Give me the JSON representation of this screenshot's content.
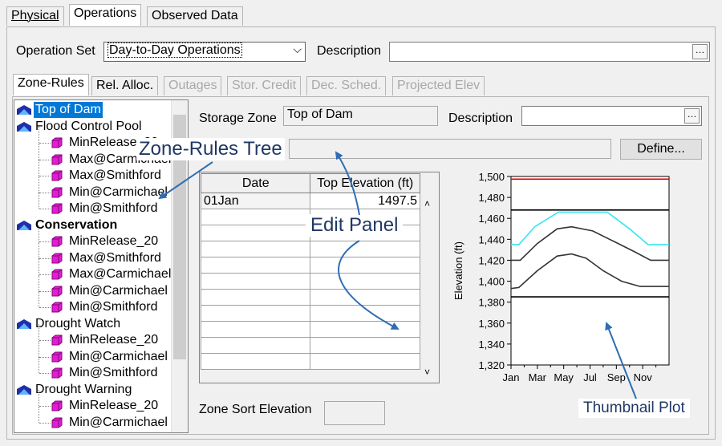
{
  "tabs": [
    {
      "label": "Physical",
      "mnemonic": "P"
    },
    {
      "label": "Operations",
      "mnemonic": "O"
    },
    {
      "label": "Observed Data",
      "mnemonic": "b"
    }
  ],
  "operation_set": {
    "label": "Operation Set",
    "value": "Day-to-Day Operations",
    "description_label": "Description",
    "description_value": ""
  },
  "subtabs": [
    {
      "label": "Zone-Rules",
      "enabled": true
    },
    {
      "label": "Rel. Alloc.",
      "enabled": true
    },
    {
      "label": "Outages",
      "enabled": false
    },
    {
      "label": "Stor. Credit",
      "enabled": false
    },
    {
      "label": "Dec. Sched.",
      "enabled": false
    },
    {
      "label": "Projected Elev",
      "enabled": false
    }
  ],
  "tree": [
    {
      "label": "Top of Dam",
      "level": 0,
      "bold": false,
      "selected": true
    },
    {
      "label": "Flood Control Pool",
      "level": 0,
      "bold": false
    },
    {
      "label": "MinRelease_20",
      "level": 1
    },
    {
      "label": "Max@Carmichael",
      "level": 1
    },
    {
      "label": "Max@Smithford",
      "level": 1
    },
    {
      "label": "Min@Carmichael",
      "level": 1
    },
    {
      "label": "Min@Smithford",
      "level": 1
    },
    {
      "label": "Conservation",
      "level": 0,
      "bold": true
    },
    {
      "label": "MinRelease_20",
      "level": 1
    },
    {
      "label": "Max@Smithford",
      "level": 1
    },
    {
      "label": "Max@Carmichael",
      "level": 1
    },
    {
      "label": "Min@Carmichael",
      "level": 1
    },
    {
      "label": "Min@Smithford",
      "level": 1
    },
    {
      "label": "Drought Watch",
      "level": 0,
      "bold": false
    },
    {
      "label": "MinRelease_20",
      "level": 1
    },
    {
      "label": "Min@Carmichael",
      "level": 1
    },
    {
      "label": "Min@Smithford",
      "level": 1
    },
    {
      "label": "Drought Warning",
      "level": 0,
      "bold": false
    },
    {
      "label": "MinRelease_20",
      "level": 1
    },
    {
      "label": "Min@Carmichael",
      "level": 1
    }
  ],
  "storage_zone": {
    "label": "Storage Zone",
    "value": "Top of Dam",
    "description_label": "Description",
    "description_value": ""
  },
  "define_button": "Define...",
  "table": {
    "headers": [
      "Date",
      "Top Elevation (ft)"
    ],
    "rows": [
      [
        "01Jan",
        "1497.5"
      ],
      [
        "",
        ""
      ],
      [
        "",
        ""
      ],
      [
        "",
        ""
      ],
      [
        "",
        ""
      ],
      [
        "",
        ""
      ],
      [
        "",
        ""
      ],
      [
        "",
        ""
      ],
      [
        "",
        ""
      ],
      [
        "",
        ""
      ],
      [
        "",
        ""
      ]
    ]
  },
  "zone_sort_elevation": {
    "label": "Zone Sort Elevation",
    "value": ""
  },
  "callouts": {
    "tree": "Zone-Rules Tree",
    "edit": "Edit Panel",
    "plot": "Thumbnail Plot"
  },
  "colors": {
    "selection": "#0078d7",
    "callout_arrow": "#2e6db4",
    "top_of_dam_line": "#e00000",
    "cyan_line": "#33e6f0",
    "folder_icon": "#1f2fa8",
    "cube_icon": "#e020d0"
  },
  "chart_data": {
    "type": "line",
    "ylabel": "Elevation (ft)",
    "xlabel": "",
    "title": "",
    "x_ticks": [
      "Jan",
      "Mar",
      "May",
      "Jul",
      "Sep",
      "Nov"
    ],
    "x_tick_months": [
      0,
      2,
      4,
      6,
      8,
      10
    ],
    "xlim": [
      0,
      12
    ],
    "ylim": [
      1320,
      1500
    ],
    "y_ticks": [
      1320,
      1340,
      1360,
      1380,
      1400,
      1420,
      1440,
      1460,
      1480,
      1500
    ],
    "y_tick_labels": [
      "1,320",
      "1,340",
      "1,360",
      "1,380",
      "1,400",
      "1,420",
      "1,440",
      "1,460",
      "1,480",
      "1,500"
    ],
    "series": [
      {
        "color": "#e00000",
        "points": [
          [
            0,
            1497.5
          ],
          [
            12,
            1497.5
          ]
        ]
      },
      {
        "color": "#000000",
        "points": [
          [
            0,
            1468
          ],
          [
            12,
            1468
          ]
        ]
      },
      {
        "color": "#33e6f0",
        "points": [
          [
            0,
            1435
          ],
          [
            0.6,
            1435
          ],
          [
            1.8,
            1452
          ],
          [
            3.6,
            1466
          ],
          [
            7.3,
            1466
          ],
          [
            9.0,
            1450
          ],
          [
            10.4,
            1435
          ],
          [
            12,
            1435
          ]
        ]
      },
      {
        "color": "#333333",
        "points": [
          [
            0,
            1420
          ],
          [
            0.7,
            1420
          ],
          [
            2.0,
            1436
          ],
          [
            3.5,
            1450
          ],
          [
            4.6,
            1452
          ],
          [
            6.2,
            1448
          ],
          [
            7.8,
            1438
          ],
          [
            9.4,
            1428
          ],
          [
            10.6,
            1420
          ],
          [
            12,
            1420
          ]
        ]
      },
      {
        "color": "#333333",
        "points": [
          [
            0,
            1393
          ],
          [
            0.6,
            1394
          ],
          [
            2.0,
            1410
          ],
          [
            3.5,
            1424
          ],
          [
            4.6,
            1426
          ],
          [
            5.7,
            1422
          ],
          [
            7.0,
            1410
          ],
          [
            8.4,
            1400
          ],
          [
            9.8,
            1395
          ],
          [
            12,
            1395
          ]
        ]
      },
      {
        "color": "#000000",
        "points": [
          [
            0,
            1385
          ],
          [
            12,
            1385
          ]
        ]
      }
    ]
  }
}
